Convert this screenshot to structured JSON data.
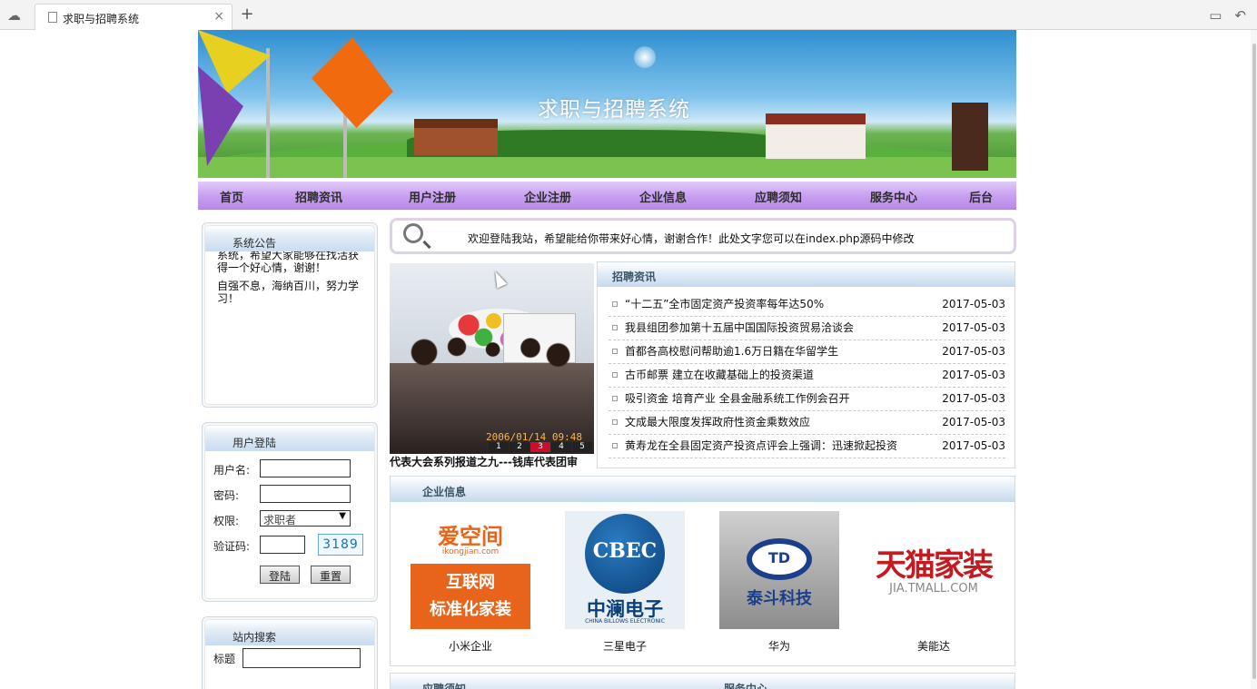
{
  "browser": {
    "tab_title": "求职与招聘系统",
    "close_glyph": "×",
    "new_tab_glyph": "+"
  },
  "banner": {
    "title": "求职与招聘系统"
  },
  "nav": {
    "items": [
      {
        "label": "首页"
      },
      {
        "label": "招聘资讯"
      },
      {
        "label": "用户注册"
      },
      {
        "label": "企业注册"
      },
      {
        "label": "企业信息"
      },
      {
        "label": "应聘须知"
      },
      {
        "label": "服务中心"
      },
      {
        "label": "后台"
      }
    ]
  },
  "notice": {
    "title": "系统公告",
    "lines": [
      "系统，希望大家能够在找活获得一个好心情，谢谢！",
      "自强不息，海纳百川，努力学习！"
    ]
  },
  "login": {
    "title": "用户登陆",
    "username_label": "用户名:",
    "password_label": "密码:",
    "role_label": "权限:",
    "role_value": "求职者",
    "captcha_label": "验证码:",
    "captcha_code": "3189",
    "login_button": "登陆",
    "reset_button": "重置"
  },
  "search": {
    "title": "站内搜索",
    "field_label": "标题"
  },
  "marquee": {
    "text": "欢迎登陆我站，希望能给你带来好心情，谢谢合作！此处文字您可以在index.php源码中修改"
  },
  "slideshow": {
    "timestamp": "2006/01/14 09:48",
    "pages": [
      "1",
      "2",
      "3",
      "4",
      "5"
    ],
    "active_page": "3",
    "caption": "代表大会系列报道之九---钱库代表团审"
  },
  "news": {
    "title": "招聘资讯",
    "items": [
      {
        "title": "“十二五”全市固定资产投资率每年达50%",
        "date": "2017-05-03"
      },
      {
        "title": "我县组团参加第十五届中国国际投资贸易洽谈会",
        "date": "2017-05-03"
      },
      {
        "title": "首都各高校慰问帮助逾1.6万日籍在华留学生",
        "date": "2017-05-03"
      },
      {
        "title": "古币邮票 建立在收藏基础上的投资渠道",
        "date": "2017-05-03"
      },
      {
        "title": "吸引资金 培育产业 全县金融系统工作例会召开",
        "date": "2017-05-03"
      },
      {
        "title": "文成最大限度发挥政府性资金乘数效应",
        "date": "2017-05-03"
      },
      {
        "title": "黄寿龙在全县固定资产投资点评会上强调：迅速掀起投资",
        "date": "2017-05-03"
      }
    ]
  },
  "companies": {
    "title": "企业信息",
    "items": [
      {
        "name": "小米企业",
        "logo_text": [
          "爱空间",
          "ikongjian.com",
          "互联网",
          "标准化家装"
        ]
      },
      {
        "name": "三星电子",
        "logo_text": [
          "CBEC",
          "中澜电子",
          "CHINA BILLOWS ELECTRONIC"
        ]
      },
      {
        "name": "华为",
        "logo_text": [
          "TD",
          "泰斗科技"
        ]
      },
      {
        "name": "美能达",
        "logo_text": [
          "天猫家装",
          "JIA.TMALL.COM"
        ]
      }
    ]
  },
  "bottom_panels": {
    "left_title": "应聘须知",
    "right_title": "服务中心"
  }
}
